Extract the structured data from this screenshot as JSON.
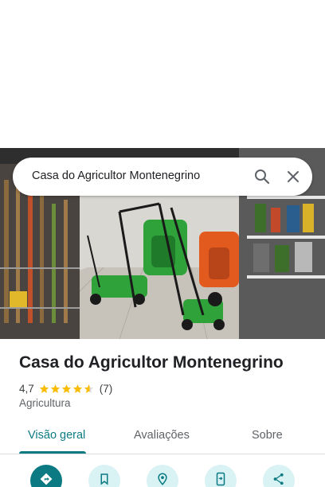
{
  "search": {
    "query": "Casa do Agricultor Montenegrino"
  },
  "place": {
    "name": "Casa do Agricultor Montenegrino",
    "rating": "4,7",
    "stars": 4.7,
    "review_count": "(7)",
    "category": "Agricultura"
  },
  "tabs": [
    {
      "label": "Visão geral",
      "active": true
    },
    {
      "label": "Avaliações",
      "active": false
    },
    {
      "label": "Sobre",
      "active": false
    }
  ],
  "actions": [
    {
      "icon": "directions-icon"
    },
    {
      "icon": "bookmark-icon"
    },
    {
      "icon": "nearby-icon"
    },
    {
      "icon": "send-to-phone-icon"
    },
    {
      "icon": "share-icon"
    }
  ],
  "colors": {
    "accent": "#0b7a82",
    "star": "#fbbc04",
    "action_bg": "#d9f2f4"
  }
}
